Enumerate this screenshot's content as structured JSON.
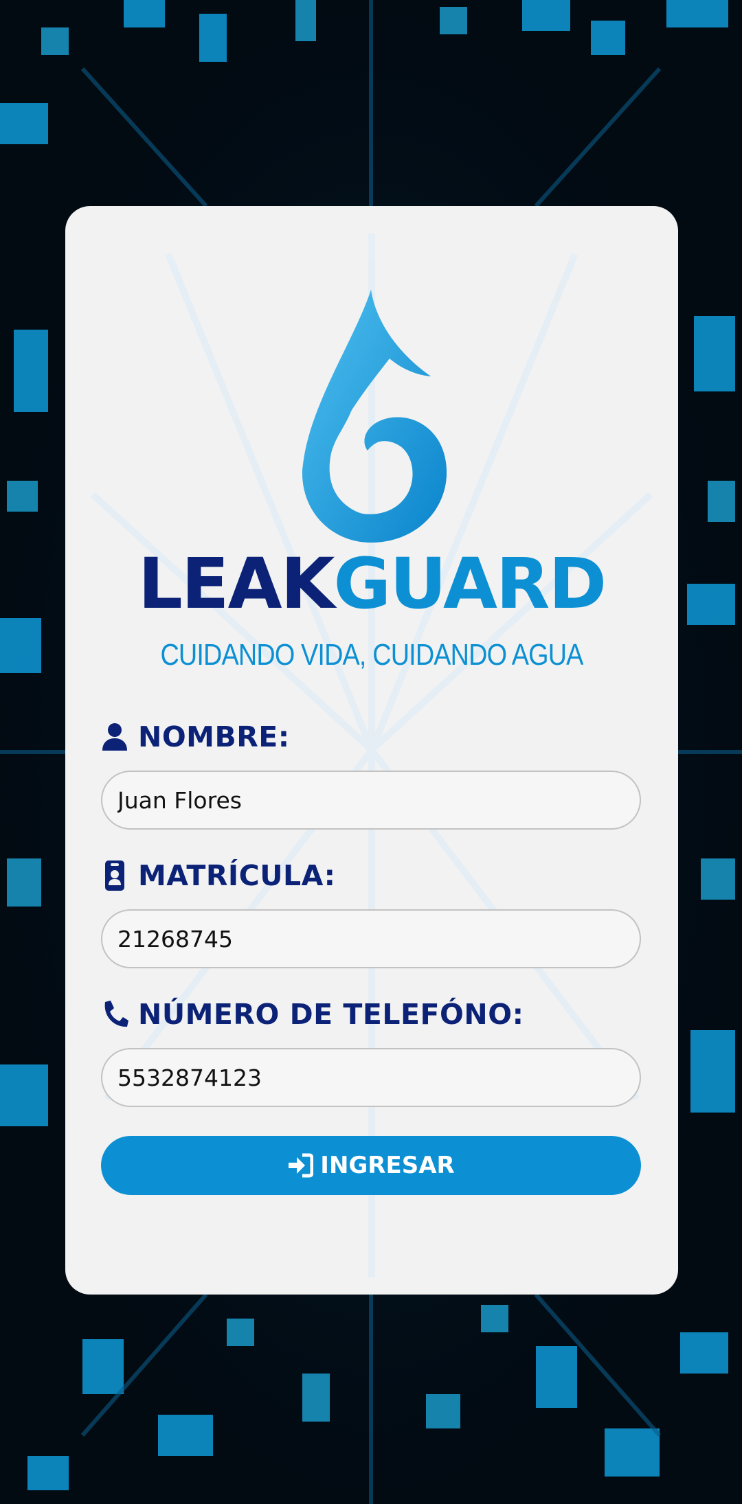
{
  "brand": {
    "name_part1": "LEAK",
    "name_part2": "GUARD",
    "tagline": "CUIDANDO VIDA, CUIDANDO AGUA",
    "logo_icon": "water-drop-logo"
  },
  "form": {
    "name": {
      "label": "NOMBRE:",
      "icon": "user-icon",
      "value": "Juan Flores"
    },
    "id": {
      "label": "MATRÍCULA:",
      "icon": "id-badge-icon",
      "value": "21268745"
    },
    "phone": {
      "label": "NÚMERO DE TELEFÓNO:",
      "icon": "phone-icon",
      "value": "5532874123"
    },
    "submit": {
      "label": "INGRESAR",
      "icon": "sign-in-icon"
    }
  },
  "colors": {
    "navy": "#0b2277",
    "accent": "#0c90d3",
    "card": "#f2f2f2",
    "background": "#020a12"
  }
}
